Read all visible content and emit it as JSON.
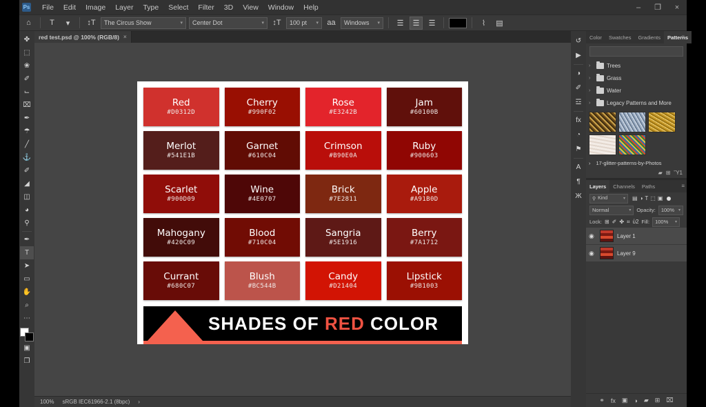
{
  "app": {
    "name": "Adobe Photoshop",
    "logo_text": "Ps"
  },
  "titlebar": {
    "menu": [
      "File",
      "Edit",
      "Image",
      "Layer",
      "Type",
      "Select",
      "Filter",
      "3D",
      "View",
      "Window",
      "Help"
    ],
    "window_controls": {
      "minimize": "–",
      "restore": "❐",
      "close": "×"
    }
  },
  "options_bar": {
    "home_icon": "⌂",
    "tool_icon": "T",
    "orientation_icon": "↕T",
    "font_family": "The Circus Show",
    "font_style": "Center Dot",
    "size_icon": "↕T",
    "font_size": "100 pt",
    "aa_icon": "aa",
    "anti_aliasing": "Windows",
    "align_left": "☰",
    "align_center": "☰",
    "align_right": "☰",
    "color_swatch": "#000000",
    "warp_icon": "⌇",
    "panels_icon": "▤",
    "dropdown_arrow": "▾"
  },
  "toolbar": {
    "tools": [
      {
        "name": "move-tool",
        "glyph": "✤"
      },
      {
        "name": "marquee-tool",
        "glyph": "⬚"
      },
      {
        "name": "lasso-tool",
        "glyph": "❀"
      },
      {
        "name": "quick-selection-tool",
        "glyph": "✐"
      },
      {
        "name": "crop-tool",
        "glyph": "⌙"
      },
      {
        "name": "frame-tool",
        "glyph": "⌧"
      },
      {
        "name": "eyedropper-tool",
        "glyph": "✒"
      },
      {
        "name": "healing-brush-tool",
        "glyph": "☂"
      },
      {
        "name": "brush-tool",
        "glyph": "╱"
      },
      {
        "name": "clone-stamp-tool",
        "glyph": "⚓"
      },
      {
        "name": "history-brush-tool",
        "glyph": "✐"
      },
      {
        "name": "eraser-tool",
        "glyph": "◢"
      },
      {
        "name": "gradient-tool",
        "glyph": "◫"
      },
      {
        "name": "blur-tool",
        "glyph": "◕"
      },
      {
        "name": "dodge-tool",
        "glyph": "⚲"
      },
      {
        "name": "pen-tool",
        "glyph": "✒"
      },
      {
        "name": "type-tool",
        "glyph": "T",
        "active": true
      },
      {
        "name": "path-selection-tool",
        "glyph": "➤"
      },
      {
        "name": "rectangle-tool",
        "glyph": "▭"
      },
      {
        "name": "hand-tool",
        "glyph": "✋"
      },
      {
        "name": "zoom-tool",
        "glyph": "⌕"
      },
      {
        "name": "more-tools",
        "glyph": "⋯"
      }
    ],
    "foreground_color": "#ffffff",
    "background_color": "#000000",
    "quick_mask_icon": "▣",
    "screen_mode_icon": "❐"
  },
  "document": {
    "tab_title": "red test.psd @ 100% (RGB/8)",
    "close_glyph": "×"
  },
  "statusbar": {
    "zoom": "100%",
    "color_profile": "sRGB IEC61966-2.1 (8bpc)",
    "arrow": "›"
  },
  "artwork": {
    "banner": {
      "text_before": "SHADES OF ",
      "highlight": "RED",
      "text_after": " COLOR"
    },
    "swatches": [
      {
        "name": "Red",
        "hex": "#D0312D"
      },
      {
        "name": "Cherry",
        "hex": "#990F02"
      },
      {
        "name": "Rose",
        "hex": "#E3242B"
      },
      {
        "name": "Jam",
        "hex": "#60100B"
      },
      {
        "name": "Merlot",
        "hex": "#541E1B"
      },
      {
        "name": "Garnet",
        "hex": "#610C04"
      },
      {
        "name": "Crimson",
        "hex": "#B90E0A"
      },
      {
        "name": "Ruby",
        "hex": "#900603"
      },
      {
        "name": "Scarlet",
        "hex": "#900D09"
      },
      {
        "name": "Wine",
        "hex": "#4E0707"
      },
      {
        "name": "Brick",
        "hex": "#7E2811"
      },
      {
        "name": "Apple",
        "hex": "#A91B0D"
      },
      {
        "name": "Mahogany",
        "hex": "#420C09"
      },
      {
        "name": "Blood",
        "hex": "#710C04"
      },
      {
        "name": "Sangria",
        "hex": "#5E1916"
      },
      {
        "name": "Berry",
        "hex": "#7A1712"
      },
      {
        "name": "Currant",
        "hex": "#680C07"
      },
      {
        "name": "Blush",
        "hex": "#BC544B"
      },
      {
        "name": "Candy",
        "hex": "#D21404"
      },
      {
        "name": "Lipstick",
        "hex": "#9B1003"
      }
    ]
  },
  "right_rail": {
    "icons": [
      {
        "name": "history-panel-icon",
        "glyph": "↺"
      },
      {
        "name": "actions-panel-icon",
        "glyph": "▶"
      },
      {
        "name": "adjustments-panel-icon",
        "glyph": "◑"
      },
      {
        "name": "brush-settings-panel-icon",
        "glyph": "✐"
      },
      {
        "name": "properties-panel-icon",
        "glyph": "☲"
      },
      {
        "name": "styles-panel-icon",
        "glyph": "fx"
      },
      {
        "name": "swatches-panel-icon",
        "glyph": "◔"
      },
      {
        "name": "clone-source-panel-icon",
        "glyph": "⚑"
      },
      {
        "name": "character-panel-icon",
        "glyph": "A"
      },
      {
        "name": "paragraph-panel-icon",
        "glyph": "¶"
      },
      {
        "name": "glyphs-panel-icon",
        "glyph": "Ж"
      }
    ]
  },
  "patterns_panel": {
    "tabs": [
      {
        "label": "Color",
        "active": false
      },
      {
        "label": "Swatches",
        "active": false
      },
      {
        "label": "Gradients",
        "active": false
      },
      {
        "label": "Patterns",
        "active": true
      }
    ],
    "menu_glyph": "≡",
    "folders": [
      "Trees",
      "Grass",
      "Water",
      "Legacy Patterns and More"
    ],
    "caret": "›",
    "pattern_swatches": [
      "pattern-1",
      "pattern-2",
      "pattern-3",
      "pattern-4",
      "pattern-5"
    ],
    "truncated_folder": "17-glitter-patterns-by-Photos",
    "footer_icons": [
      "new-folder-icon",
      "new-pattern-icon",
      "delete-icon"
    ],
    "footer_glyphs": [
      "▰",
      "⊞",
      "Ὕ1"
    ]
  },
  "layers_panel": {
    "tabs": [
      {
        "label": "Layers",
        "active": true
      },
      {
        "label": "Channels",
        "active": false
      },
      {
        "label": "Paths",
        "active": false
      }
    ],
    "menu_glyph": "≡",
    "filter_label": "Kind",
    "filter_icon": "⚲",
    "filter_types": [
      "▤",
      "◑",
      "T",
      "⬚",
      "▣"
    ],
    "blend_mode": "Normal",
    "opacity_label": "Opacity:",
    "opacity_value": "100%",
    "lock_label": "Lock:",
    "lock_icons": [
      "⊞",
      "✐",
      "✤",
      "⌗",
      "ὑ2"
    ],
    "fill_label": "Fill:",
    "fill_value": "100%",
    "layers": [
      {
        "name": "Layer 1",
        "visible": true
      },
      {
        "name": "Layer 9",
        "visible": true
      }
    ],
    "eye_glyph": "◉",
    "footer_icons": [
      "link-icon",
      "fx-icon",
      "mask-icon",
      "adjustment-icon",
      "group-icon",
      "new-layer-icon",
      "delete-layer-icon"
    ],
    "footer_glyphs": [
      "⚭",
      "fx",
      "▣",
      "◑",
      "▰",
      "⊞",
      "⌧"
    ]
  }
}
